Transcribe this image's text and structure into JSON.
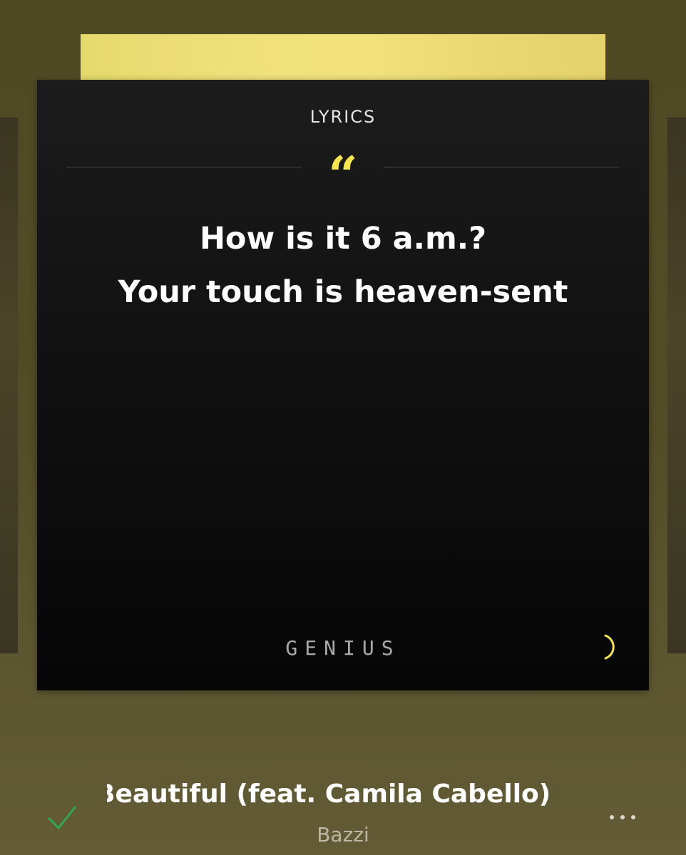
{
  "lyrics_card": {
    "heading": "LYRICS",
    "lines": [
      "How is it 6 a.m.?",
      "Your touch is heaven-sent"
    ],
    "provider": "GENIUS",
    "accent_color": "#f5e64e"
  },
  "now_playing": {
    "title": "Beautiful (feat. Camila Cabello)",
    "artist": "Bazzi"
  },
  "icons": {
    "quote": "open-quote-icon",
    "loading": "loading-spinner-icon",
    "saved": "check-icon",
    "more": "more-options-icon"
  },
  "colors": {
    "background": "#524c27",
    "card": "#111111",
    "check": "#2fa84f"
  }
}
